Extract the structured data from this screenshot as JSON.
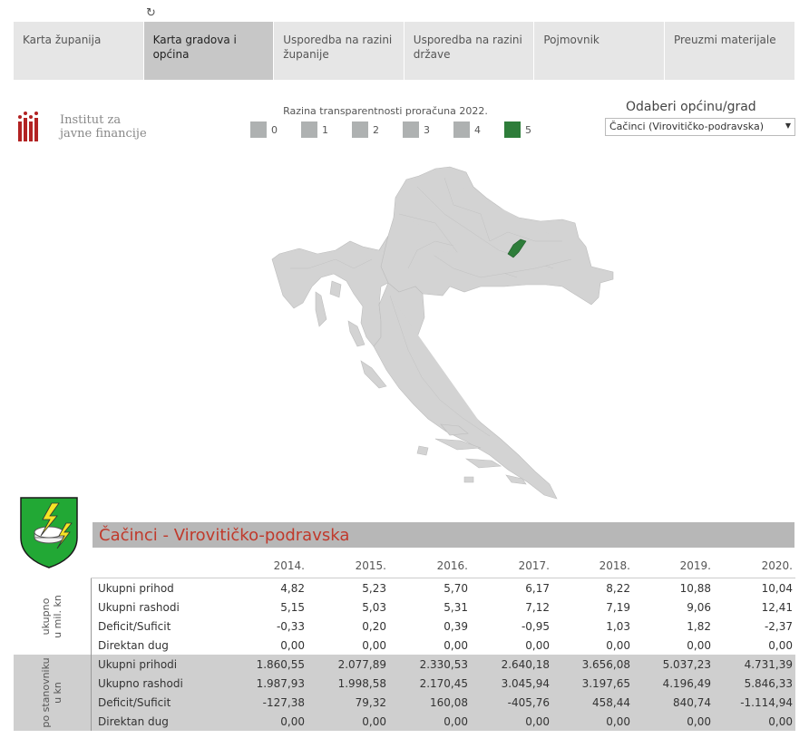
{
  "nav": {
    "tabs": [
      {
        "label": "Karta županija",
        "active": false
      },
      {
        "label": "Karta gradova i općina",
        "active": true
      },
      {
        "label": "Usporedba na razini županije",
        "active": false
      },
      {
        "label": "Usporedba na razini države",
        "active": false
      },
      {
        "label": "Pojmovnik",
        "active": false
      },
      {
        "label": "Preuzmi materijale",
        "active": false
      }
    ]
  },
  "logo": {
    "text": "Institut za javne financije",
    "color": "#b22222"
  },
  "legend": {
    "title": "Razina transparentnosti proračuna 2022.",
    "items": [
      {
        "label": "0",
        "color": "#aeb1b1"
      },
      {
        "label": "1",
        "color": "#aeb1b1"
      },
      {
        "label": "2",
        "color": "#aeb1b1"
      },
      {
        "label": "3",
        "color": "#aeb1b1"
      },
      {
        "label": "4",
        "color": "#aeb1b1"
      },
      {
        "label": "5",
        "color": "#2e7d3a"
      }
    ]
  },
  "selector": {
    "title": "Odaberi općinu/grad",
    "value": "Čačinci (Virovitičko-podravska)"
  },
  "map": {
    "base_color": "#d3d3d3",
    "highlight_color": "#2e7d3a"
  },
  "municipality": {
    "title": "Čačinci - Virovitičko-podravska",
    "title_color": "#c0392b"
  },
  "table": {
    "years": [
      "2014.",
      "2015.",
      "2016.",
      "2017.",
      "2018.",
      "2019.",
      "2020."
    ],
    "sections": [
      {
        "side_label_1": "ukupno",
        "side_label_2": "u mil. kn",
        "rows": [
          {
            "label": "Ukupni prihod",
            "values": [
              "4,82",
              "5,23",
              "5,70",
              "6,17",
              "8,22",
              "10,88",
              "10,04"
            ]
          },
          {
            "label": "Ukupni rashodi",
            "values": [
              "5,15",
              "5,03",
              "5,31",
              "7,12",
              "7,19",
              "9,06",
              "12,41"
            ]
          },
          {
            "label": "Deficit/Suficit",
            "values": [
              "-0,33",
              "0,20",
              "0,39",
              "-0,95",
              "1,03",
              "1,82",
              "-2,37"
            ]
          },
          {
            "label": "Direktan dug",
            "values": [
              "0,00",
              "0,00",
              "0,00",
              "0,00",
              "0,00",
              "0,00",
              "0,00"
            ]
          }
        ]
      },
      {
        "side_label_1": "po stanovniku",
        "side_label_2": "u kn",
        "rows": [
          {
            "label": "Ukupni prihodi",
            "values": [
              "1.860,55",
              "2.077,89",
              "2.330,53",
              "2.640,18",
              "3.656,08",
              "5.037,23",
              "4.731,39"
            ]
          },
          {
            "label": "Ukupno rashodi",
            "values": [
              "1.987,93",
              "1.998,58",
              "2.170,45",
              "3.045,94",
              "3.197,65",
              "4.196,49",
              "5.846,33"
            ]
          },
          {
            "label": "Deficit/Suficit",
            "values": [
              "-127,38",
              "79,32",
              "160,08",
              "-405,76",
              "458,44",
              "840,74",
              "-1.114,94"
            ]
          },
          {
            "label": "Direktan dug",
            "values": [
              "0,00",
              "0,00",
              "0,00",
              "0,00",
              "0,00",
              "0,00",
              "0,00"
            ]
          }
        ]
      }
    ]
  }
}
